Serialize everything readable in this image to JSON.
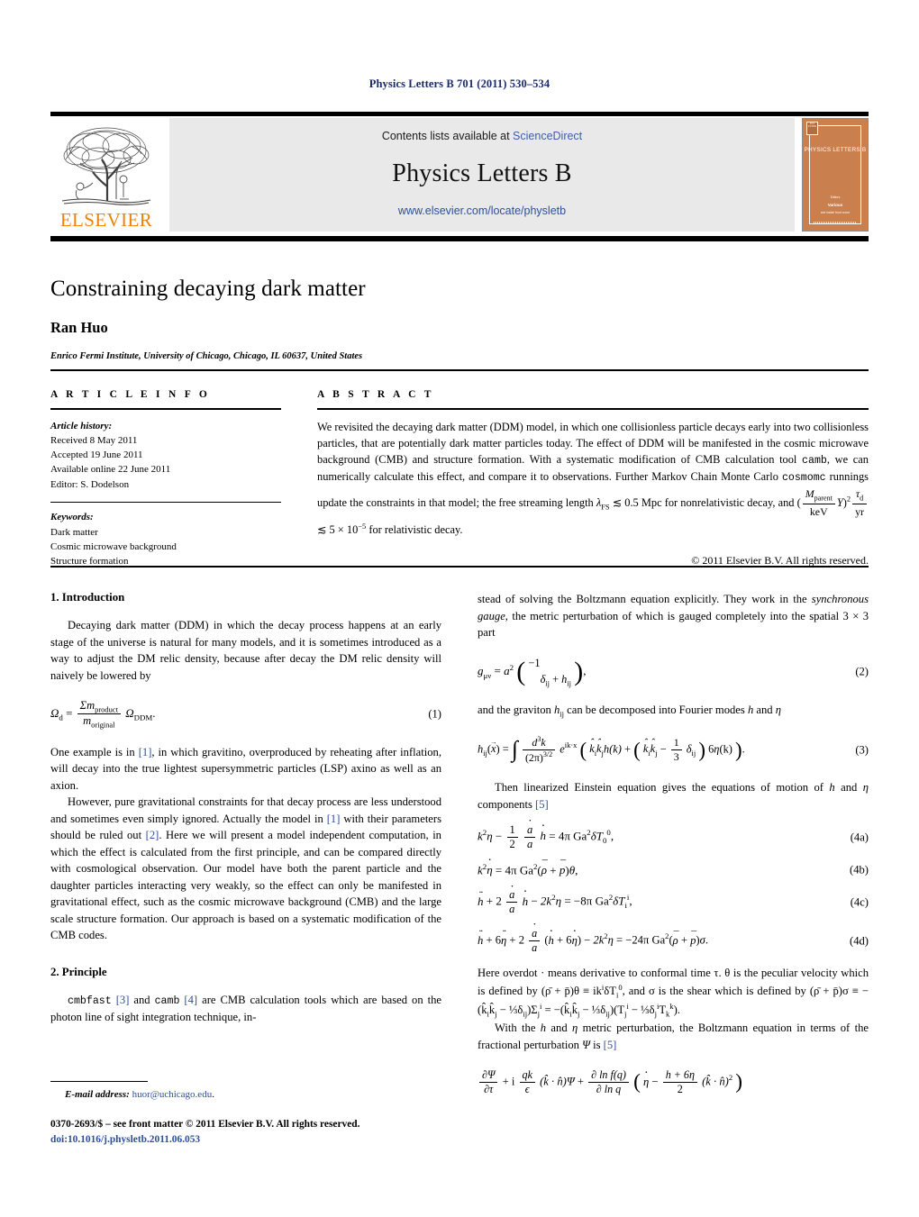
{
  "running_head": "Physics Letters B 701 (2011) 530–534",
  "masthead": {
    "contents_prefix": "Contents lists available at ",
    "sciencedirect": "ScienceDirect",
    "journal_title": "Physics Letters B",
    "journal_url": "www.elsevier.com/locate/physletb",
    "publisher_wordmark": "ELSEVIER",
    "cover": {
      "title": "PHYSICS LETTERS B",
      "editor_label": "Editors",
      "editor_name": "Various",
      "editor_sub": "see inside front cover"
    },
    "accent_orange": "#ef8200",
    "link_blue": "#2d4f9e",
    "banner_gray": "#e9e9e9"
  },
  "title": "Constraining decaying dark matter",
  "author": "Ran Huo",
  "affiliation": "Enrico Fermi Institute, University of Chicago, Chicago, IL 60637, United States",
  "article_info": {
    "label": "A R T I C L E    I N F O",
    "history_label": "Article history:",
    "received": "Received 8 May 2011",
    "accepted": "Accepted 19 June 2011",
    "available": "Available online 22 June 2011",
    "editor": "Editor: S. Dodelson",
    "keywords_label": "Keywords:",
    "keywords": [
      "Dark matter",
      "Cosmic microwave background",
      "Structure formation"
    ]
  },
  "abstract": {
    "label": "A B S T R A C T",
    "part1": "We revisited the decaying dark matter (DDM) model, in which one collisionless particle decays early into two collisionless particles, that are potentially dark matter particles today. The effect of DDM will be manifested in the cosmic microwave background (CMB) and structure formation. With a systematic modification of CMB calculation tool ",
    "code1": "camb",
    "part2": ", we can numerically calculate this effect, and compare it to observations. Further Markov Chain Monte Carlo ",
    "code2": "cosmomc",
    "part3": " runnings update the constraints in that model; the free streaming length ",
    "lambda_fs": "λ",
    "lambda_fs_sub": "FS",
    "lesssim": "≲",
    "bound1": "0.5 Mpc",
    "part4": " for nonrelativistic decay, and (",
    "mass_num": "M",
    "mass_num_sub": "parent",
    "mass_den": "keV",
    "yield": "Y",
    "exp2": "2",
    "td_num": "τ",
    "td_num_sub": "d",
    "td_den": "yr",
    "bound2": "5 × 10",
    "bound2_exp": "−5",
    "part5": " for relativistic decay.",
    "copyright": "© 2011 Elsevier B.V. All rights reserved."
  },
  "left_column": {
    "section1_heading": "1. Introduction",
    "para1": "Decaying dark matter (DDM) in which the decay process happens at an early stage of the universe is natural for many models, and it is sometimes introduced as a way to adjust the DM relic density, because after decay the DM relic density will naively be lowered by",
    "eq1": {
      "lhs": "Ω",
      "lhs_sub": "d",
      "eq": "=",
      "num": "Σm",
      "num_sub": "product",
      "den": "m",
      "den_sub": "original",
      "tail": "Ω",
      "tail_sub": "DDM",
      "period": ".",
      "number": "(1)"
    },
    "para2_a": "One example is in ",
    "para2_ref1": "[1]",
    "para2_b": ", in which gravitino, overproduced by reheating after inflation, will decay into the true lightest supersymmetric particles (LSP) axino as well as an axion.",
    "para3_a": "However, pure gravitational constraints for that decay process are less understood and sometimes even simply ignored. Actually the model in ",
    "para3_ref1": "[1]",
    "para3_b": " with their parameters should be ruled out ",
    "para3_ref2": "[2]",
    "para3_c": ". Here we will present a model independent computation, in which the effect is calculated from the first principle, and can be compared directly with cosmological observation. Our model have both the parent particle and the daughter particles interacting very weakly, so the effect can only be manifested in gravitational effect, such as the cosmic microwave background (CMB) and the large scale structure formation. Our approach is based on a systematic modification of the CMB codes.",
    "section2_heading": "2. Principle",
    "para4_code1": "cmbfast",
    "para4_ref1": "[3]",
    "para4_mid": " and ",
    "para4_code2": "camb",
    "para4_ref2": "[4]",
    "para4_tail": " are CMB calculation tools which are based on the photon line of sight integration technique, in-"
  },
  "right_column": {
    "para1_a": "stead of solving the Boltzmann equation explicitly. They work in the ",
    "para1_italic": "synchronous gauge",
    "para1_b": ", the metric perturbation of which is gauged completely into the spatial 3 × 3 part",
    "eq2": {
      "lhs": "g",
      "lhs_sub": "μν",
      "eq": "=",
      "a": "a",
      "a_exp": "2",
      "m11": "−1",
      "m22_d": "δ",
      "m22_d_sub": "ij",
      "m22_plus": "+",
      "m22_h": "h",
      "m22_h_sub": "ij",
      "comma": ",",
      "number": "(2)"
    },
    "para2_a": "and the graviton ",
    "para2_h": "h",
    "para2_h_sub": "ij",
    "para2_b": " can be decomposed into Fourier modes ",
    "para2_h2": "h",
    "para2_c": " and ",
    "para2_eta": "η",
    "eq3": {
      "lhs_h": "h",
      "lhs_sub": "ij",
      "lhs_x": "x",
      "eq": "=",
      "int": "∫",
      "num": "d",
      "num_exp": "3",
      "num_k": "k",
      "den": "(2π)",
      "den_exp": "3/2",
      "exp_e": "e",
      "exp_arg": "ik·x",
      "t1_k1": "k",
      "t1_k1_sub": "i",
      "t1_k2": "k",
      "t1_k2_sub": "j",
      "t1_h": "h(k)",
      "plus": "+",
      "t2_k1": "k",
      "t2_k1_sub": "i",
      "t2_k2": "k",
      "t2_k2_sub": "j",
      "minus": "−",
      "frac_n": "1",
      "frac_d": "3",
      "delta": "δ",
      "delta_sub": "ij",
      "six": "6",
      "eta": "η",
      "eta_arg": "(k)",
      "period": ".",
      "number": "(3)"
    },
    "para3_a": "Then linearized Einstein equation gives the equations of motion of ",
    "para3_h": "h",
    "para3_b": " and ",
    "para3_eta": "η",
    "para3_c": " components ",
    "para3_ref": "[5]",
    "eq4a": {
      "k": "k",
      "k_exp": "2",
      "eta": "η",
      "minus": "−",
      "f1n": "1",
      "f1d": "2",
      "f2n": "a",
      "f2d": "a",
      "h": "h",
      "eq": "=",
      "rhs": "4π Ga",
      "rhs_exp": "2",
      "delta": "δT",
      "delta_sub": "0",
      "delta_sup": "0",
      "comma": ",",
      "number": "(4a)"
    },
    "eq4b": {
      "k": "k",
      "k_exp": "2",
      "eta": "η",
      "eq": "=",
      "rhs": "4π Ga",
      "rhs_exp": "2",
      "rho": "ρ",
      "plus": "+",
      "p": "p",
      "theta": "θ",
      "comma": ",",
      "number": "(4b)"
    },
    "eq4c": {
      "h": "h",
      "plus": "+",
      "two": "2",
      "f2n": "a",
      "f2d": "a",
      "hdot": "h",
      "minus": "−",
      "twok": "2k",
      "twok_exp": "2",
      "eta": "η",
      "eq": "=",
      "rhs": "−8π Ga",
      "rhs_exp": "2",
      "delta": "δT",
      "delta_sub": "i",
      "delta_sup": "i",
      "comma": ",",
      "number": "(4c)"
    },
    "eq4d": {
      "h": "h",
      "plus1": "+",
      "six": "6",
      "eta1": "η",
      "plus2": "+",
      "two": "2",
      "f2n": "a",
      "f2d": "a",
      "lp": "(",
      "hdot": "h",
      "plus3": "+",
      "six2": "6",
      "eta2": "η",
      "rp": ")",
      "minus": "−",
      "twok": "2k",
      "twok_exp": "2",
      "eta3": "η",
      "eq": "=",
      "rhs": "−24π Ga",
      "rhs_exp": "2",
      "rho": "ρ",
      "plusr": "+",
      "p": "p",
      "sigma": "σ",
      "period": ".",
      "number": "(4d)"
    },
    "para4": "Here overdot · means derivative to conformal time τ. θ is the peculiar velocity which is defined by (ρ̄ + p̄)θ ≡ ik",
    "para4_b": "δT",
    "para4_c": ", and σ is the shear which is defined by (ρ̄ + p̄)σ ≡ −(k̂",
    "para4_d": "k̂",
    "para4_e": " − ⅓δ",
    "para4_f": ")Σ",
    "para4_g": " = −(k̂",
    "para4_h": "k̂",
    "para4_i": " − ⅓δ",
    "para4_j": ")(T",
    "para4_k": " − ⅓δ",
    "para4_l": "T",
    "para4_m": ").",
    "para5_a": "With the ",
    "para5_h": "h",
    "para5_b": " and ",
    "para5_eta": "η",
    "para5_c": " metric perturbation, the Boltzmann equation in terms of the fractional perturbation ",
    "para5_psi": "Ψ",
    "para5_d": " is ",
    "para5_ref": "[5]",
    "eq5": {
      "f1n": "∂Ψ",
      "f1d": "∂τ",
      "plus1": "+ i",
      "f2n": "qk",
      "f2d": "ϵ",
      "dot1": "(k̂ · n̂)Ψ",
      "plus2": "+",
      "f3n": "∂ ln f(q)",
      "f3d": "∂ ln q",
      "etadot": "η",
      "minus": "−",
      "f4n": "h + 6η",
      "f4d": "2",
      "tail": "(k̂ · n̂)",
      "tail_exp": "2"
    }
  },
  "footer": {
    "email_label": "E-mail address:",
    "email": "huor@uchicago.edu",
    "email_period": ".",
    "issn_line": "0370-2693/$ – see front matter  © 2011 Elsevier B.V. All rights reserved.",
    "doi": "doi:10.1016/j.physletb.2011.06.053"
  }
}
